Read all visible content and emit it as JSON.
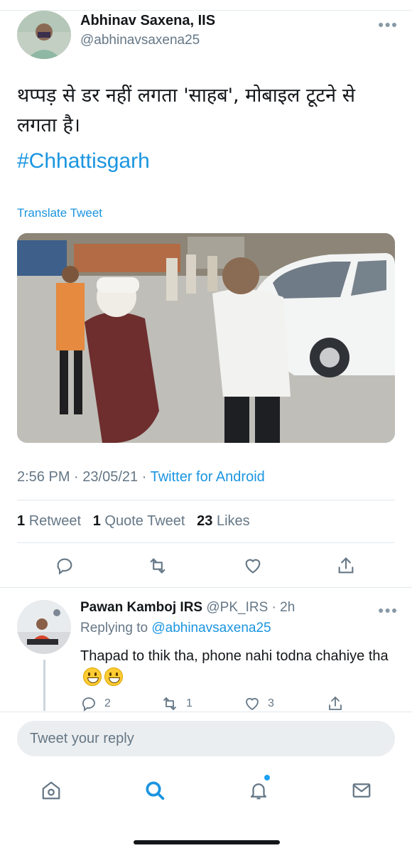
{
  "tweet": {
    "author_name": "Abhinav Saxena, IIS",
    "author_handle": "@abhinavsaxena25",
    "text": "थप्पड़ से डर नहीं लगता 'साहब', मोबाइल टूटने से लगता है।",
    "hashtag": "#Chhattisgarh",
    "translate_label": "Translate Tweet",
    "time": "2:56 PM",
    "date": "23/05/21",
    "source": "Twitter for Android",
    "separator": "·"
  },
  "stats": {
    "retweets_count": "1",
    "retweets_label": "Retweet",
    "quotes_count": "1",
    "quotes_label": "Quote Tweet",
    "likes_count": "23",
    "likes_label": "Likes"
  },
  "reply": {
    "author_name": "Pawan Kamboj IRS",
    "author_handle": "@PK_IRS",
    "time": "· 2h",
    "replying_label": "Replying to",
    "replying_to": "@abhinavsaxena25",
    "text": "Thapad to thik tha, phone nahi todna chahiye tha",
    "reply_count": "2",
    "retweet_count": "1",
    "like_count": "3"
  },
  "composer": {
    "placeholder": "Tweet your reply"
  },
  "icons": {
    "reply": "reply-icon",
    "retweet": "retweet-icon",
    "like": "heart-icon",
    "share": "share-icon",
    "home": "home-icon",
    "search": "search-icon",
    "notifications": "bell-icon",
    "messages": "mail-icon",
    "more": "more-icon"
  },
  "colors": {
    "accent": "#1b95e0",
    "muted": "#657786",
    "text": "#14171a"
  }
}
